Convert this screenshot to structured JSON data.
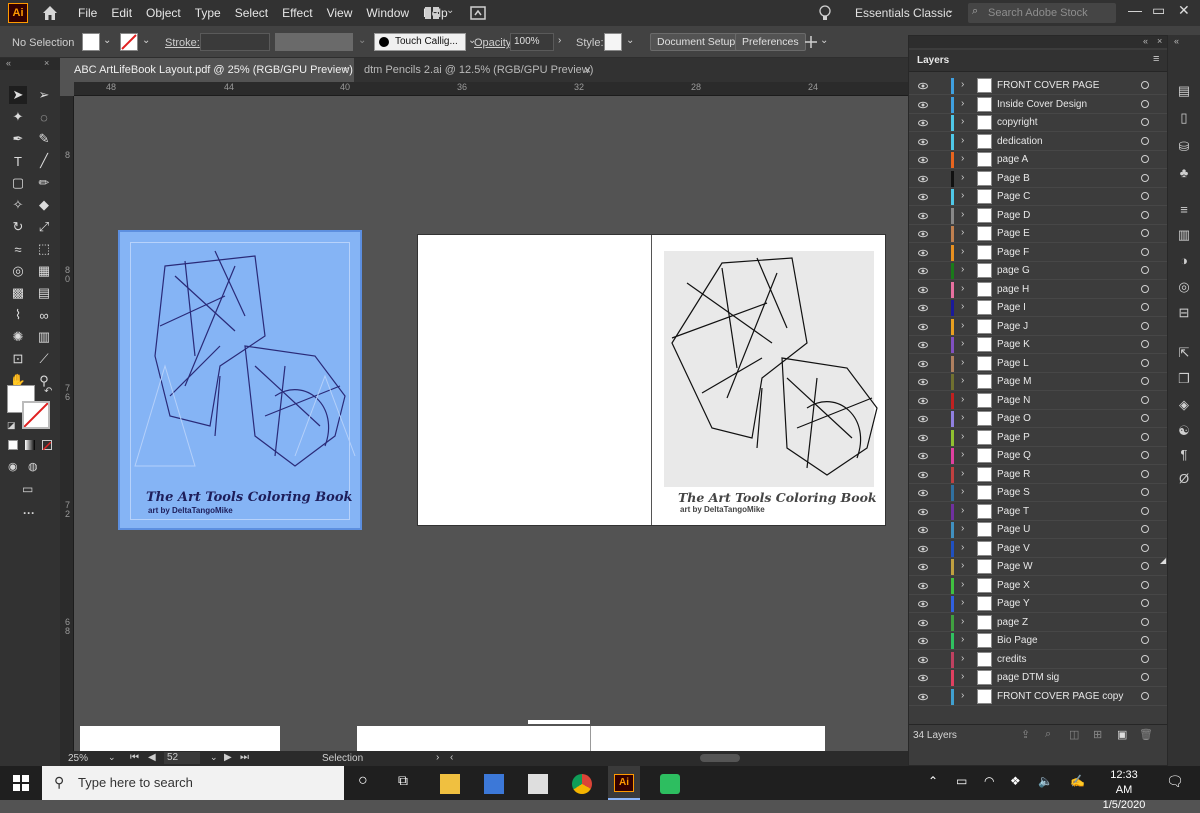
{
  "app": {
    "logo": "Ai"
  },
  "menu": [
    "File",
    "Edit",
    "Object",
    "Type",
    "Select",
    "Effect",
    "View",
    "Window",
    "Help"
  ],
  "workspace": "Essentials Classic",
  "search_stock": {
    "placeholder": "Search Adobe Stock"
  },
  "control": {
    "selection": "No Selection",
    "stroke_label": "Stroke:",
    "brush": "Touch Callig...",
    "opacity_label": "Opacity:",
    "opacity": "100%",
    "style_label": "Style:",
    "doc_setup": "Document Setup",
    "preferences": "Preferences"
  },
  "tabs": [
    {
      "label": "ABC ArtLifeBook Layout.pdf @ 25% (RGB/GPU Preview)",
      "close": "×"
    },
    {
      "label": "dtm Pencils 2.ai @ 12.5% (RGB/GPU Preview)",
      "close": "×"
    }
  ],
  "ruler_top": [
    "48",
    "44",
    "40",
    "36",
    "32",
    "28",
    "24"
  ],
  "ruler_left": [
    "8",
    "8 0",
    "7 6",
    "7 2",
    "6 8"
  ],
  "artboard_text": {
    "title": "The Art Tools Coloring Book",
    "byline": "art by DeltaTangoMike"
  },
  "status": {
    "zoom": "25%",
    "page": "52",
    "mode": "Selection"
  },
  "layers": {
    "title": "Layers",
    "count": "34 Layers",
    "items": [
      {
        "name": "FRONT COVER PAGE",
        "color": "#3fa0e0"
      },
      {
        "name": "Inside Cover Design",
        "color": "#3fa0e0"
      },
      {
        "name": "copyright",
        "color": "#4fc8e8"
      },
      {
        "name": "dedication",
        "color": "#4fc8e8"
      },
      {
        "name": "page A",
        "color": "#e8641e"
      },
      {
        "name": "Page B",
        "color": "#111111"
      },
      {
        "name": "Page C",
        "color": "#4fc8e8"
      },
      {
        "name": "Page D",
        "color": "#888888"
      },
      {
        "name": "Page E",
        "color": "#c08050"
      },
      {
        "name": "Page F",
        "color": "#e89020"
      },
      {
        "name": "page G",
        "color": "#1a7a1a"
      },
      {
        "name": "page H",
        "color": "#e870a0"
      },
      {
        "name": "Page I",
        "color": "#1a1a9a"
      },
      {
        "name": "Page J",
        "color": "#e8a020"
      },
      {
        "name": "Page K",
        "color": "#8050c0"
      },
      {
        "name": "Page L",
        "color": "#b08060"
      },
      {
        "name": "Page M",
        "color": "#707030"
      },
      {
        "name": "Page N",
        "color": "#c02020"
      },
      {
        "name": "Page O",
        "color": "#9080e0"
      },
      {
        "name": "Page P",
        "color": "#90c030"
      },
      {
        "name": "Page Q",
        "color": "#e040a0"
      },
      {
        "name": "Page R",
        "color": "#c04040"
      },
      {
        "name": "Page S",
        "color": "#3070a0"
      },
      {
        "name": "Page T",
        "color": "#7030a0"
      },
      {
        "name": "Page U",
        "color": "#4090c0"
      },
      {
        "name": "Page V",
        "color": "#2050c0"
      },
      {
        "name": "Page W",
        "color": "#c0a040"
      },
      {
        "name": "Page X",
        "color": "#40c040"
      },
      {
        "name": "Page Y",
        "color": "#3060e0"
      },
      {
        "name": "page Z",
        "color": "#40a040"
      },
      {
        "name": "Bio Page",
        "color": "#30c060"
      },
      {
        "name": "credits",
        "color": "#c04060"
      },
      {
        "name": "page DTM sig",
        "color": "#e04060"
      },
      {
        "name": "FRONT COVER PAGE copy",
        "color": "#40a0d0"
      }
    ]
  },
  "taskbar": {
    "search_placeholder": "Type here to search",
    "time": "12:33 AM",
    "date": "1/5/2020"
  }
}
